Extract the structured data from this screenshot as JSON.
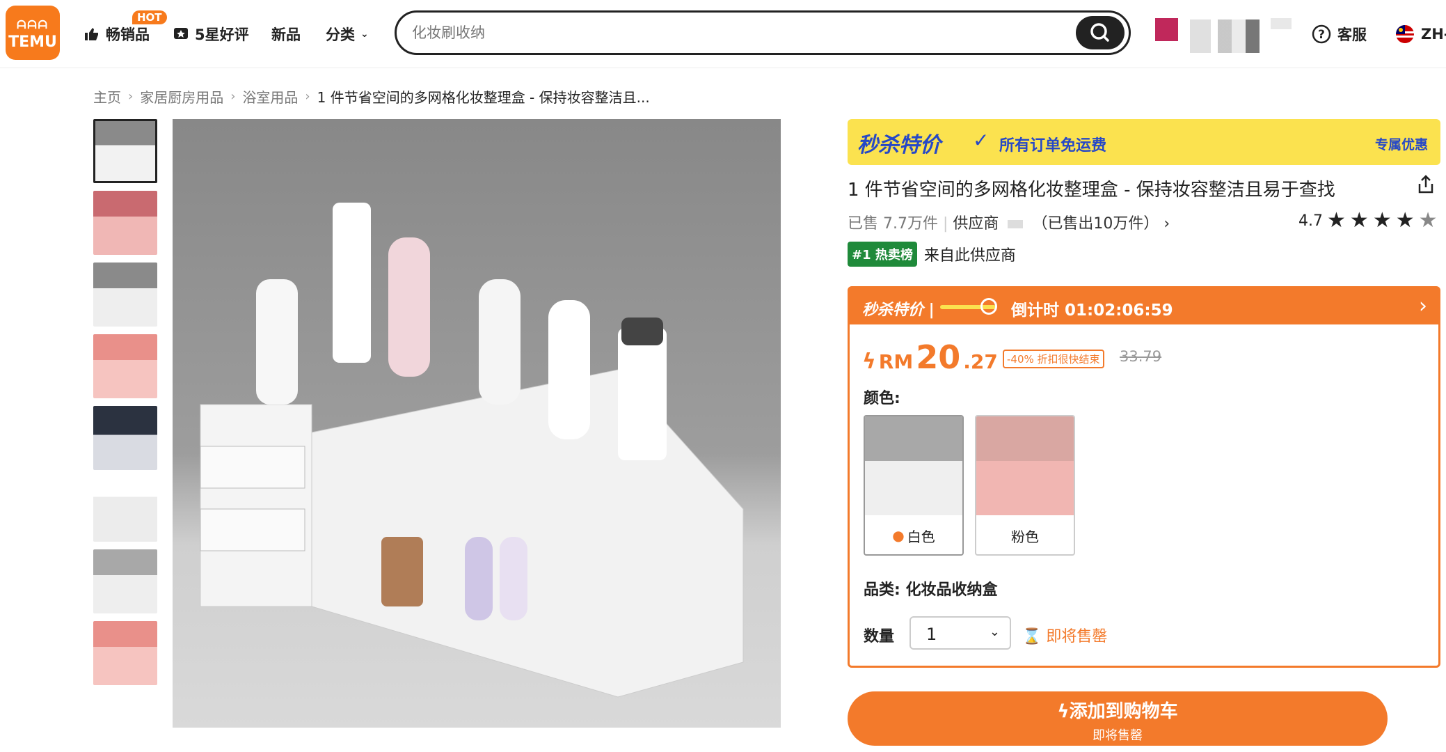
{
  "header": {
    "logo_line1": "ᗩᗩᗩ",
    "logo_line2": "TEMU",
    "nav": [
      "畅销品",
      "5星好评",
      "新品",
      "分类"
    ],
    "hot_badge": "HOT",
    "search_placeholder": "化妆刷收纳",
    "support": "客服",
    "lang": "ZH-"
  },
  "breadcrumb": [
    "主页",
    "家居厨房用品",
    "浴室用品",
    "1 件节省空间的多网格化妆整理盒 - 保持妆容整洁且..."
  ],
  "banner": {
    "badge": "秒杀特价",
    "text": "所有订单免运费",
    "right": "专属优惠"
  },
  "product": {
    "title": "1 件节省空间的多网格化妆整理盒 - 保持妆容整洁且易于查找",
    "sold": "已售 7.7万件",
    "supplier": "供应商",
    "supplier_sold": "（已售出10万件）",
    "rating": "4.7",
    "rank_tag": "#1 热卖榜",
    "rank_text": "来自此供应商"
  },
  "deal": {
    "label": "秒杀特价 |",
    "countdown": "倒计时 01:02:06:59",
    "currency": "RM",
    "price_int": "20",
    "price_dec": ".27",
    "discount": "-40% 折扣很快结束",
    "original": "33.79",
    "color_label": "颜色:",
    "colors": [
      "白色",
      "粉色"
    ],
    "category": "品类: 化妆品收纳盒",
    "qty_label": "数量",
    "qty_value": "1",
    "soon": "即将售罄"
  },
  "cart": {
    "label": "添加到购物车",
    "sub": "即将售罄"
  }
}
